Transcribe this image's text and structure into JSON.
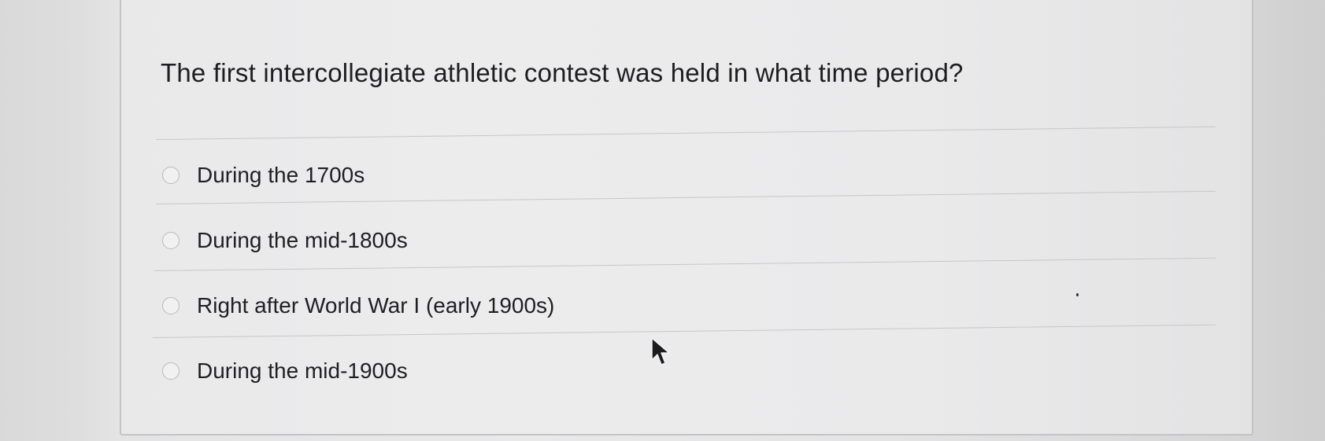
{
  "quiz": {
    "question": "The first intercollegiate athletic contest was held in what time period?",
    "options": [
      {
        "label": "During the 1700s"
      },
      {
        "label": "During the mid-1800s"
      },
      {
        "label": "Right after World War I (early 1900s)"
      },
      {
        "label": "During the mid-1900s"
      }
    ]
  },
  "icons": {
    "option_marker": "radio-button-icon",
    "pointer": "mouse-cursor-icon"
  }
}
